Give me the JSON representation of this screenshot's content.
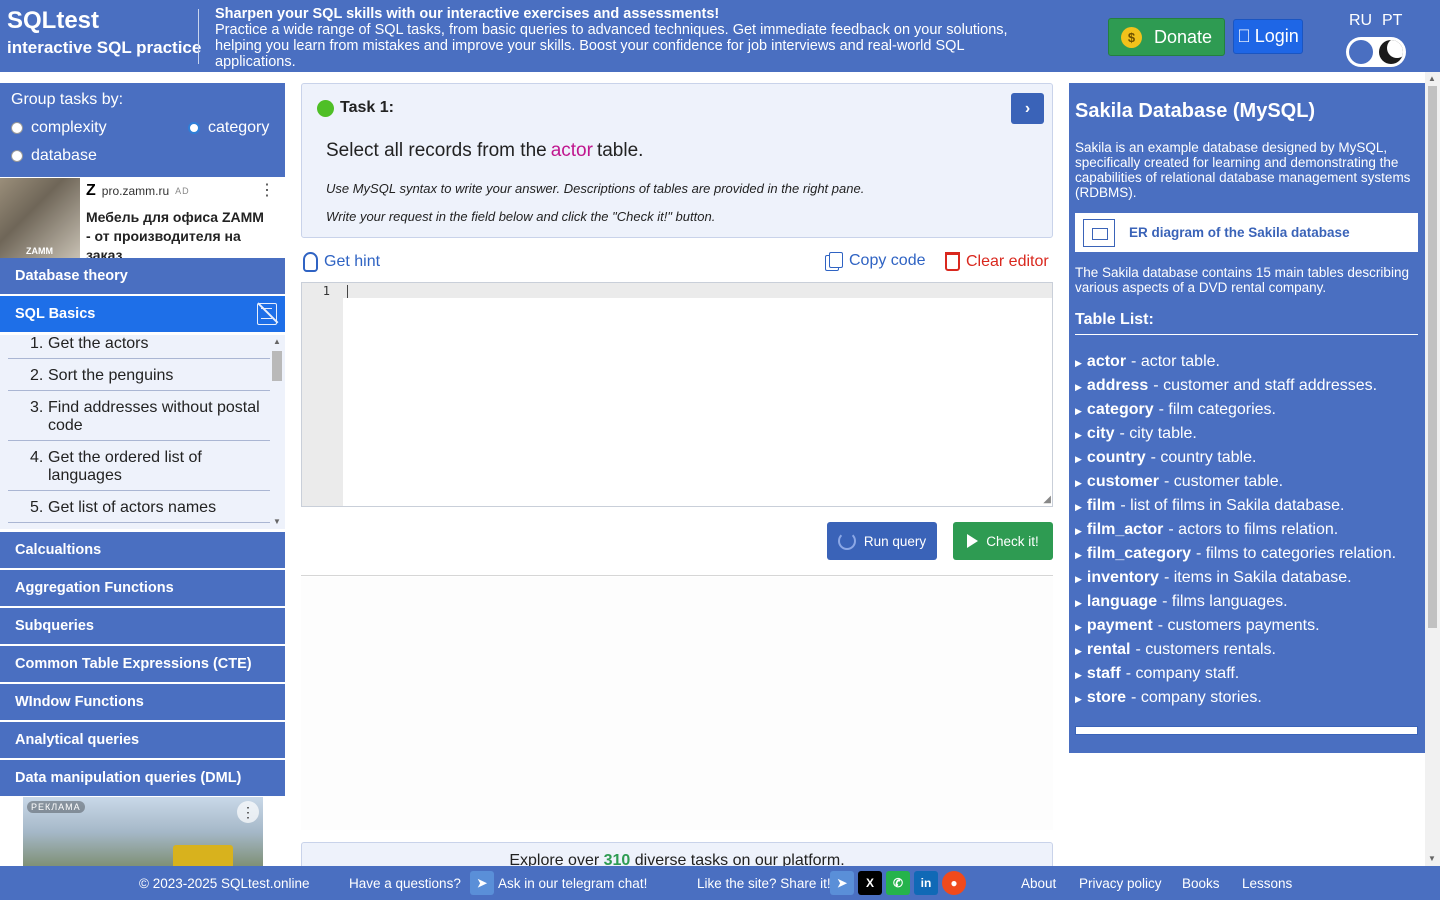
{
  "header": {
    "title": "SQLtest",
    "subtitle": "interactive SQL practice",
    "tagline_strong": "Sharpen your SQL skills with our interactive exercises and assessments!",
    "tagline": "Practice a wide range of SQL tasks, from basic queries to advanced techniques. Get immediate feedback on your solutions, helping you learn from mistakes and improve your skills. Boost your confidence for job interviews and real-world SQL applications.",
    "donate_label": "Donate",
    "donate_icon": "$",
    "login_label": "Login",
    "lang_ru": "RU",
    "lang_pt": "PT"
  },
  "sidebar": {
    "group_title": "Group tasks by:",
    "group_options": [
      {
        "label": "complexity",
        "checked": false
      },
      {
        "label": "category",
        "checked": true
      },
      {
        "label": "database",
        "checked": false
      }
    ],
    "ad1": {
      "brand": "Z",
      "domain": "pro.zamm.ru",
      "tag": "AD",
      "image_label": "ZAMM",
      "text": "Мебель для офиса ZAMM - от производителя на заказ",
      "menu": "⋮"
    },
    "nav": [
      {
        "label": "Database theory",
        "active": false
      },
      {
        "label": "SQL Basics",
        "active": true
      },
      {
        "label": "Calcualtions",
        "active": false
      },
      {
        "label": "Aggregation Functions",
        "active": false
      },
      {
        "label": "Subqueries",
        "active": false
      },
      {
        "label": "Common Table Expressions (CTE)",
        "active": false
      },
      {
        "label": "WIndow Functions",
        "active": false
      },
      {
        "label": "Analytical queries",
        "active": false
      },
      {
        "label": "Data manipulation queries (DML)",
        "active": false
      }
    ],
    "tasks": [
      {
        "num": "1.",
        "label": "Get the actors"
      },
      {
        "num": "2.",
        "label": "Sort the penguins"
      },
      {
        "num": "3.",
        "label": "Find addresses without postal code"
      },
      {
        "num": "4.",
        "label": "Get the ordered list of languages"
      },
      {
        "num": "5.",
        "label": "Get list of actors names"
      }
    ],
    "ad2": {
      "tag": "РЕКЛАМА",
      "menu": "⋮"
    }
  },
  "task": {
    "title": "Task 1:",
    "question_prefix": "Select all records from the",
    "question_keyword": "actor",
    "question_suffix": "table.",
    "note1": "Use MySQL syntax to write your answer. Descriptions of tables are provided in the right pane.",
    "note2": "Write your request in the field below and click the \"Check it!\" button.",
    "next_icon": "›"
  },
  "toolbar": {
    "hint_label": "Get hint",
    "copy_label": "Copy code",
    "clear_label": "Clear editor"
  },
  "editor": {
    "line_number": "1",
    "content": ""
  },
  "actions": {
    "run_label": "Run query",
    "check_label": "Check it!"
  },
  "explore": {
    "prefix": "Explore over",
    "count": "310",
    "suffix": "diverse tasks on our platform."
  },
  "database": {
    "title": "Sakila Database (MySQL)",
    "description": "Sakila is an example database designed by MySQL, specifically created for learning and demonstrating the capabilities of relational database management systems (RDBMS).",
    "er_label": "ER diagram of the Sakila database",
    "description2": "The Sakila database contains 15 main tables describing various aspects of a DVD rental company.",
    "table_list_title": "Table List:",
    "tables": [
      {
        "name": "actor",
        "desc": "- actor table."
      },
      {
        "name": "address",
        "desc": "- customer and staff addresses."
      },
      {
        "name": "category",
        "desc": "- film categories."
      },
      {
        "name": "city",
        "desc": "- city table."
      },
      {
        "name": "country",
        "desc": "- country table."
      },
      {
        "name": "customer",
        "desc": "- customer table."
      },
      {
        "name": "film",
        "desc": "- list of films in Sakila database."
      },
      {
        "name": "film_actor",
        "desc": "- actors to films relation."
      },
      {
        "name": "film_category",
        "desc": "- films to categories relation."
      },
      {
        "name": "inventory",
        "desc": "- items in Sakila database."
      },
      {
        "name": "language",
        "desc": "- films languages."
      },
      {
        "name": "payment",
        "desc": "- customers payments."
      },
      {
        "name": "rental",
        "desc": "- customers rentals."
      },
      {
        "name": "staff",
        "desc": "- company staff."
      },
      {
        "name": "store",
        "desc": "- company stories."
      }
    ]
  },
  "footer": {
    "copyright": "© 2023-2025 SQLtest.online",
    "questions": "Have a questions?",
    "telegram_chat": "Ask in our telegram chat!",
    "share": "Like the site? Share it!",
    "links": [
      "About",
      "Privacy policy",
      "Books",
      "Lessons"
    ],
    "social_icons": [
      "telegram-icon",
      "x-icon",
      "whatsapp-icon",
      "linkedin-icon",
      "reddit-icon"
    ]
  },
  "colors": {
    "primary": "#4a6fc1",
    "active_nav": "#1e6fe8",
    "success": "#2e9b52",
    "danger": "#d9281e",
    "keyword": "#c0178e"
  }
}
